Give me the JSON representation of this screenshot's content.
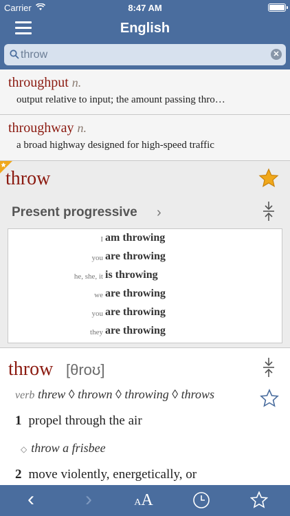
{
  "status_bar": {
    "carrier": "Carrier",
    "time": "8:47 AM"
  },
  "nav": {
    "title": "English"
  },
  "search": {
    "value": "throw"
  },
  "results": [
    {
      "headword": "throughput",
      "pos": "n.",
      "definition": "output relative to input; the amount passing thro…"
    },
    {
      "headword": "throughway",
      "pos": "n.",
      "definition": "a broad highway designed for high-speed traffic"
    }
  ],
  "entry": {
    "headword": "throw",
    "conjugation_title": "Present progressive",
    "conjugation": [
      {
        "pronoun": "I",
        "form": "am throwing"
      },
      {
        "pronoun": "you",
        "form": "are throwing"
      },
      {
        "pronoun": "he, she, it",
        "form": "is throwing"
      },
      {
        "pronoun": "we",
        "form": "are throwing"
      },
      {
        "pronoun": "you",
        "form": "are throwing"
      },
      {
        "pronoun": "they",
        "form": "are throwing"
      }
    ]
  },
  "full_entry": {
    "headword": "throw",
    "ipa": "[θroʊ]",
    "pos": "verb",
    "forms": "threw ◊ thrown ◊ throwing ◊ throws",
    "senses": [
      {
        "num": "1",
        "text": "propel through the air"
      },
      {
        "num": "2",
        "text": "move violently, energetically, or"
      }
    ],
    "example": "throw a frisbee"
  },
  "toolbar": {
    "back": "‹",
    "forward": "›",
    "font_small": "A",
    "font_big": "A"
  },
  "colors": {
    "bar": "#4a6d9e",
    "headword": "#8b1a10",
    "star": "#f0a81c"
  }
}
